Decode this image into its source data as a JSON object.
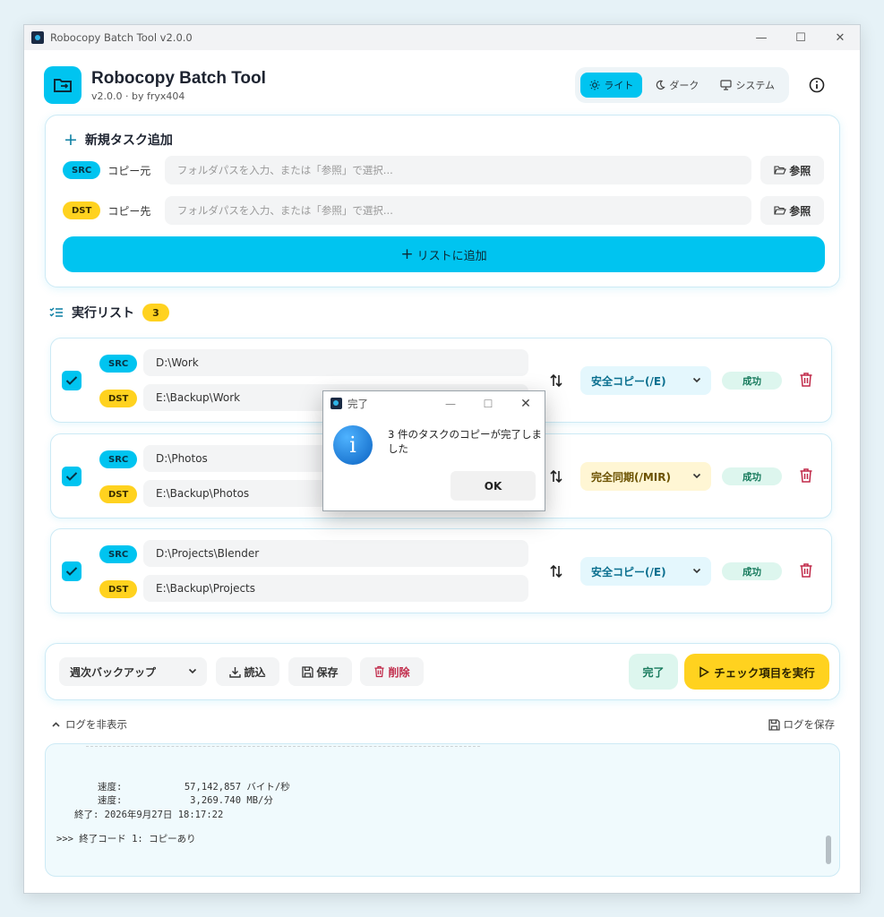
{
  "window": {
    "title": "Robocopy Batch Tool  v2.0.0",
    "controls": [
      "—",
      "☐",
      "✕"
    ]
  },
  "header": {
    "app_name": "Robocopy Batch Tool",
    "subtitle": "v2.0.0 · by fryx404",
    "theme": [
      {
        "label": "ライト",
        "icon": "sun-icon",
        "active": true
      },
      {
        "label": "ダーク",
        "icon": "moon-icon",
        "active": false
      },
      {
        "label": "システム",
        "icon": "monitor-icon",
        "active": false
      }
    ]
  },
  "add_task": {
    "title": "新規タスク追加",
    "src_tag": "SRC",
    "src_label": "コピー元",
    "src_placeholder": "フォルダパスを入力、または「参照」で選択...",
    "dst_tag": "DST",
    "dst_label": "コピー先",
    "dst_placeholder": "フォルダパスを入力、または「参照」で選択...",
    "browse_label": "参照",
    "add_button": "リストに追加"
  },
  "task_list": {
    "title": "実行リスト",
    "count": "3",
    "tasks": [
      {
        "checked": true,
        "src": "D:\\Work",
        "dst": "E:\\Backup\\Work",
        "mode": "安全コピー(/E)",
        "status": "成功"
      },
      {
        "checked": true,
        "src": "D:\\Photos",
        "dst": "E:\\Backup\\Photos",
        "mode": "完全同期(/MIR)",
        "status": "成功"
      },
      {
        "checked": true,
        "src": "D:\\Projects\\Blender",
        "dst": "E:\\Backup\\Projects",
        "mode": "安全コピー(/E)",
        "status": "成功"
      }
    ]
  },
  "bottom": {
    "preset": "週次バックアップ",
    "load": "読込",
    "save": "保存",
    "delete": "削除",
    "done": "完了",
    "run": "チェック項目を実行"
  },
  "log": {
    "toggle": "ログを非表示",
    "save": "ログを保存",
    "lines": [
      "速度:           57,142,857 バイト/秒",
      "速度:            3,269.740 MB/分",
      "終了: 2026年9月27日 18:17:22",
      ">>> 終了コード 1: コピーあり"
    ]
  },
  "dialog": {
    "title": "完了",
    "message": "3 件のタスクのコピーが完了しました",
    "ok": "OK"
  },
  "colors": {
    "accent": "#00c4f0",
    "yellow": "#ffd21f",
    "success": "#177a5c",
    "danger": "#c02848"
  }
}
